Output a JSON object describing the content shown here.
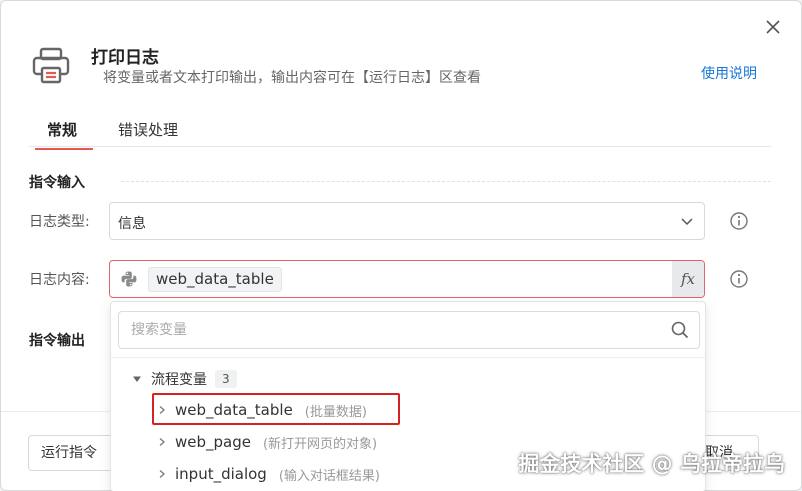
{
  "dialog": {
    "title": "打印日志",
    "subtitle": "将变量或者文本打印输出，输出内容可在【运行日志】区查看",
    "help_link": "使用说明"
  },
  "tabs": [
    {
      "label": "常规",
      "active": true
    },
    {
      "label": "错误处理",
      "active": false
    }
  ],
  "input_section": {
    "title": "指令输入",
    "log_type_label": "日志类型:",
    "log_type_value": "信息",
    "log_content_label": "日志内容:",
    "log_content_chip": "web_data_table",
    "fx_label": "fx"
  },
  "output_section": {
    "title": "指令输出"
  },
  "dropdown": {
    "search_placeholder": "搜索变量",
    "group_label": "流程变量",
    "group_count": "3",
    "variables": [
      {
        "name": "web_data_table",
        "desc": "(批量数据)",
        "highlighted": true
      },
      {
        "name": "web_page",
        "desc": "(新打开网页的对象)",
        "highlighted": false
      },
      {
        "name": "input_dialog",
        "desc": "(输入对话框结果)",
        "highlighted": false
      }
    ]
  },
  "footer": {
    "run_label": "运行指令",
    "cancel_label": "取消"
  },
  "watermark": "掘金技术社区 @ 乌拉帝拉乌",
  "colors": {
    "accent": "#1677d8",
    "tab_indicator": "#e8564c",
    "error_border": "#e0656b",
    "highlight_box": "#d4231e"
  },
  "icons": {
    "header": "printer-icon",
    "close": "close-icon",
    "select": "chevron-down-icon",
    "info": "info-icon",
    "content": "python-icon",
    "search": "search-icon",
    "group": "caret-down-icon",
    "variable": "chevron-right-icon"
  }
}
